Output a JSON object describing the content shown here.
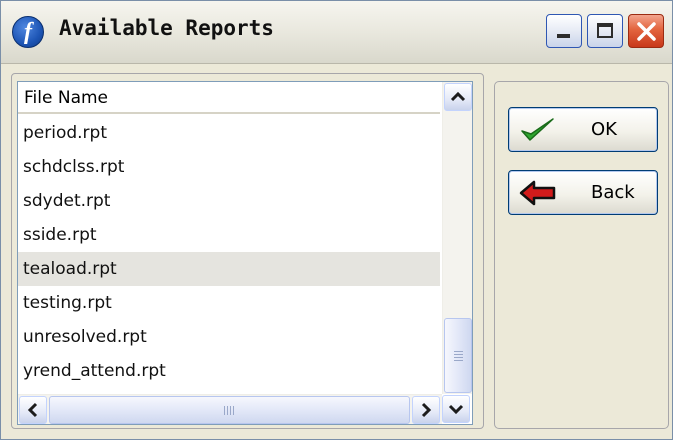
{
  "window": {
    "title": "Available Reports",
    "app_icon_glyph": "f",
    "app_icon_name": "app-logo-icon",
    "controls": [
      "minimize",
      "maximize",
      "close"
    ]
  },
  "list": {
    "header": "File Name",
    "items": [
      "period.rpt",
      "schdclss.rpt",
      "sdydet.rpt",
      "sside.rpt",
      "teaload.rpt",
      "testing.rpt",
      "unresolved.rpt",
      "yrend_attend.rpt"
    ],
    "selected_item": "teaload.rpt"
  },
  "buttons": {
    "ok_label": "OK",
    "ok_icon": "green-checkmark-icon",
    "back_label": "Back",
    "back_icon": "red-left-arrow-icon"
  },
  "colors": {
    "dialog_background": "#ECE9D8",
    "selection_background": "#e5e4df",
    "close_button": "#d9542f",
    "ok_check": "#2fa62f",
    "back_arrow": "#d21b1b"
  }
}
